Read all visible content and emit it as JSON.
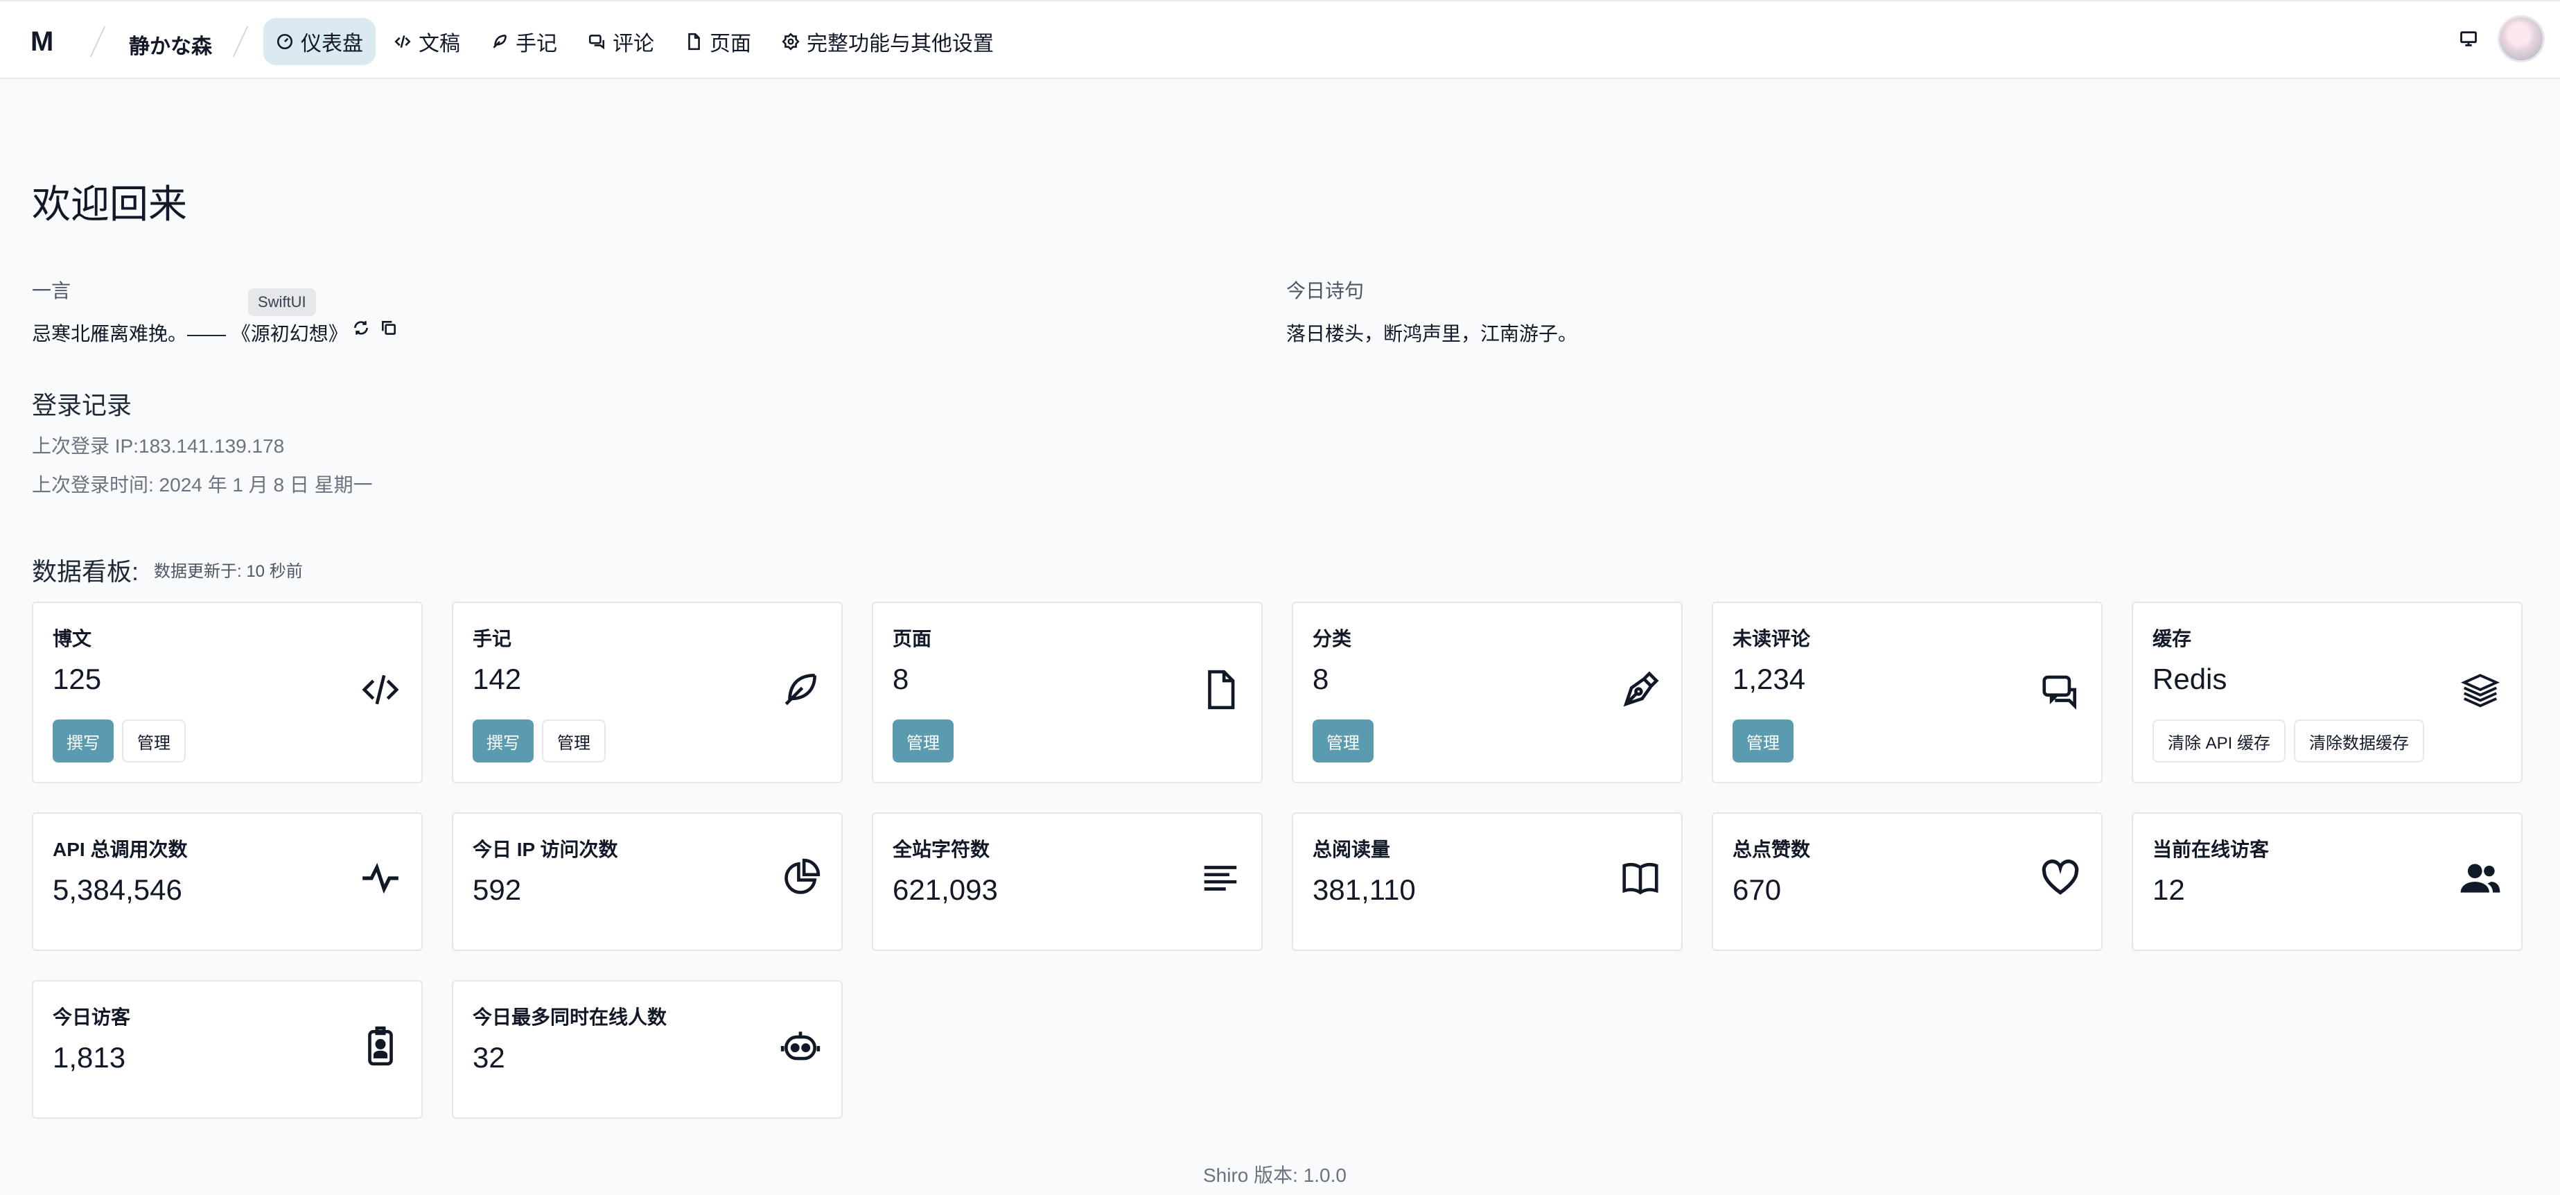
{
  "header": {
    "logo": "M",
    "site_name": "静かな森",
    "nav": [
      {
        "label": "仪表盘",
        "icon": "dashboard-icon",
        "active": true
      },
      {
        "label": "文稿",
        "icon": "code-icon"
      },
      {
        "label": "手记",
        "icon": "feather-icon"
      },
      {
        "label": "评论",
        "icon": "comment-icon"
      },
      {
        "label": "页面",
        "icon": "file-icon"
      },
      {
        "label": "完整功能与其他设置",
        "icon": "settings-icon"
      }
    ]
  },
  "main": {
    "title": "欢迎回来",
    "hitokoto": {
      "label": "一言",
      "text": "忌寒北雁离难挽。—— 《源初幻想》",
      "tooltip": "SwiftUI"
    },
    "poem": {
      "label": "今日诗句",
      "text": "落日楼头，断鸿声里，江南游子。"
    },
    "login": {
      "title": "登录记录",
      "ip": "上次登录 IP:183.141.139.178",
      "time": "上次登录时间: 2024 年 1 月 8 日 星期一"
    },
    "dashboard": {
      "title": "数据看板:",
      "updated": "数据更新于:  10 秒前"
    },
    "cards_row1": [
      {
        "title": "博文",
        "value": "125",
        "icon": "code-icon",
        "buttons": [
          "撰写",
          "管理"
        ]
      },
      {
        "title": "手记",
        "value": "142",
        "icon": "feather-icon",
        "buttons": [
          "撰写",
          "管理"
        ]
      },
      {
        "title": "页面",
        "value": "8",
        "icon": "file-icon",
        "buttons": [
          "管理"
        ]
      },
      {
        "title": "分类",
        "value": "8",
        "icon": "pen-nib-icon",
        "buttons": [
          "管理"
        ]
      },
      {
        "title": "未读评论",
        "value": "1,234",
        "icon": "chat-icon",
        "buttons": [
          "管理"
        ]
      },
      {
        "title": "缓存",
        "value": "Redis",
        "icon": "stack-icon",
        "buttons": [
          "清除 API 缓存",
          "清除数据缓存"
        ]
      }
    ],
    "cards_row2": [
      {
        "title": "API 总调用次数",
        "value": "5,384,546",
        "icon": "pulse-icon"
      },
      {
        "title": "今日 IP 访问次数",
        "value": "592",
        "icon": "pie-chart-icon"
      },
      {
        "title": "全站字符数",
        "value": "621,093",
        "icon": "text-lines-icon"
      },
      {
        "title": "总阅读量",
        "value": "381,110",
        "icon": "book-icon"
      },
      {
        "title": "总点赞数",
        "value": "670",
        "icon": "heart-icon"
      },
      {
        "title": "当前在线访客",
        "value": "12",
        "icon": "users-icon"
      }
    ],
    "cards_row3": [
      {
        "title": "今日访客",
        "value": "1,813",
        "icon": "badge-icon"
      },
      {
        "title": "今日最多同时在线人数",
        "value": "32",
        "icon": "robot-icon"
      }
    ]
  },
  "footer": {
    "version": "Shiro 版本:  1.0.0"
  },
  "colors": {
    "accent": "#5b9bb0",
    "nav_active": "#dbeaf0",
    "background": "#f8fafc"
  }
}
